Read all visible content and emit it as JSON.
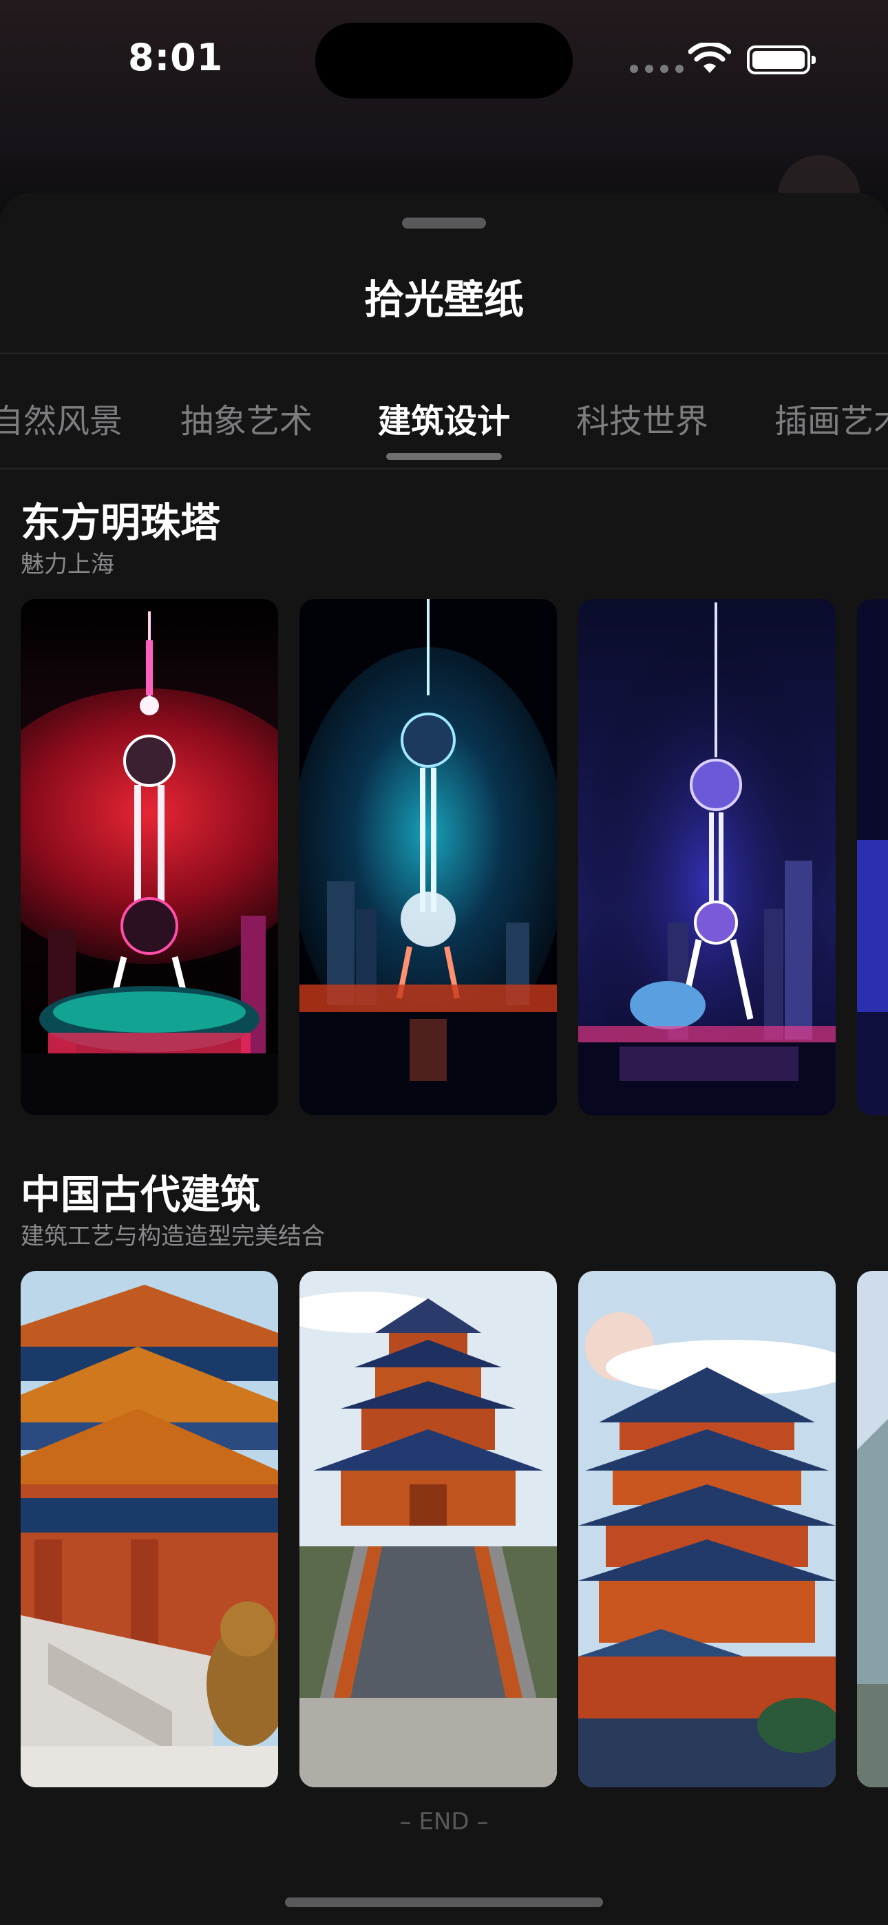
{
  "status_bar": {
    "time": "8:01"
  },
  "sheet": {
    "title": "拾光壁纸"
  },
  "tabs": [
    {
      "label": "自然风景"
    },
    {
      "label": "抽象艺术"
    },
    {
      "label": "建筑设计"
    },
    {
      "label": "科技世界"
    },
    {
      "label": "插画艺术"
    }
  ],
  "active_tab": "建筑设计",
  "sections": [
    {
      "title": "东方明珠塔",
      "subtitle": "魅力上海",
      "wallpapers": [
        "pearl-tower-red",
        "pearl-tower-cyan",
        "pearl-tower-purple",
        "pearl-tower-blue"
      ]
    },
    {
      "title": "中国古代建筑",
      "subtitle": "建筑工艺与构造造型完美结合",
      "wallpapers": [
        "palace-gate",
        "pagoda-stairs",
        "pagoda-tower",
        "mountain-pavilion"
      ]
    }
  ],
  "footer": {
    "end_label": "– END –"
  }
}
